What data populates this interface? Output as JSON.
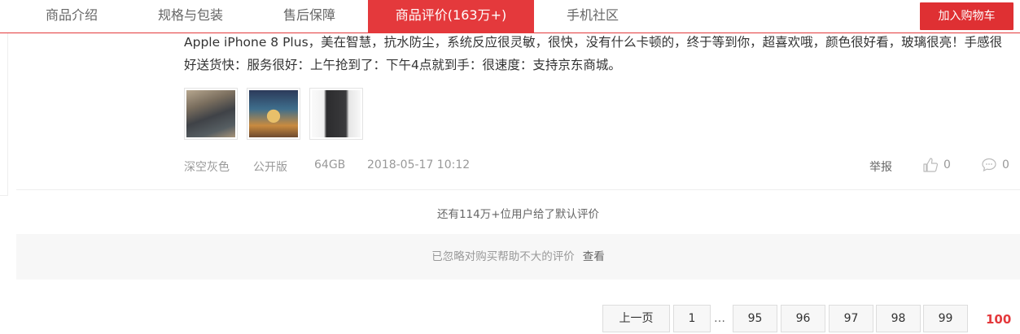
{
  "tabs": [
    {
      "label": "商品介绍"
    },
    {
      "label": "规格与包装"
    },
    {
      "label": "售后保障"
    },
    {
      "label": "商品评价(163万+)"
    },
    {
      "label": "手机社区"
    }
  ],
  "add_cart_label": "加入购物车",
  "review": {
    "text": "Apple iPhone 8 Plus，美在智慧，抗水防尘，系统反应很灵敏，很快，没有什么卡顿的，终于等到你，超喜欢哦，颜色很好看，玻璃很亮！手感很好送货快：服务很好：上午抢到了：下午4点就到手：很速度：支持京东商城。",
    "color": "深空灰色",
    "version": "公开版",
    "storage": "64GB",
    "date": "2018-05-17 10:12",
    "report_label": "举报",
    "likes": "0",
    "comments": "0"
  },
  "default_review_notice": "还有114万+位用户给了默认评价",
  "ignored_notice": "已忽略对购买帮助不大的评价",
  "ignored_view_label": "查看",
  "pagination": {
    "prev": "上一页",
    "first": "1",
    "ellipsis": "…",
    "pages": [
      "95",
      "96",
      "97",
      "98",
      "99"
    ],
    "current": "100"
  },
  "colors": {
    "accent": "#e4393c"
  }
}
